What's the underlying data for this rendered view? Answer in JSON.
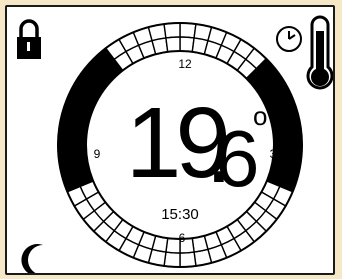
{
  "display": {
    "temperature_whole": "19",
    "temperature_dot": ".",
    "temperature_decimal": "6",
    "degree_symbol": "o",
    "time": "15:30"
  },
  "dial": {
    "labels": {
      "top": "12",
      "right": "3",
      "bottom": "6",
      "left": "9"
    },
    "segments_total": 48,
    "active_segments": [
      6,
      7,
      8,
      9,
      10,
      11,
      12,
      13,
      14,
      33,
      34,
      35,
      36,
      37,
      38,
      39,
      40,
      41,
      42
    ],
    "ring_color": "#000000"
  },
  "icons": {
    "top_left": "padlock-icon",
    "top_right_clock": "clock-icon",
    "top_right_thermo": "thermometer-icon",
    "bottom_left": "moon-icon"
  },
  "colors": {
    "background": "#f6e7c6",
    "screen": "#ffffff",
    "ink": "#000000"
  }
}
